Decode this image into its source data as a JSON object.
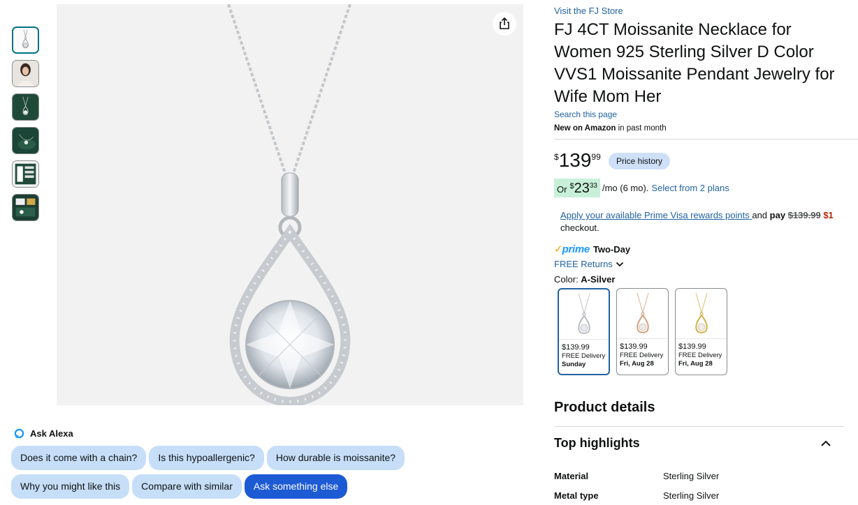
{
  "gallery": {
    "thumbnails": [
      {
        "name": "thumb-pendant-white"
      },
      {
        "name": "thumb-model-wearing"
      },
      {
        "name": "thumb-green-box"
      },
      {
        "name": "thumb-green-display"
      },
      {
        "name": "thumb-infographic"
      },
      {
        "name": "thumb-certificate"
      }
    ],
    "share_icon": "share-icon"
  },
  "alexa": {
    "heading": "Ask Alexa",
    "chips_row1": [
      "Does it come with a chain?",
      "Is this hypoallergenic?",
      "How durable is moissanite?"
    ],
    "chips_row2": [
      "Why you might like this",
      "Compare with similar",
      "Ask something else"
    ]
  },
  "product": {
    "store_link": "Visit the FJ Store",
    "title": "FJ 4CT Moissanite Necklace for Women 925 Sterling Silver D Color VVS1 Moissanite Pendant Jewelry for Wife Mom Her",
    "search_page": "Search this page",
    "new_label": "New on Amazon",
    "new_suffix": " in past month",
    "price": {
      "symbol": "$",
      "whole": "139",
      "fraction": "99"
    },
    "price_history": "Price history",
    "monthly": {
      "or": "Or",
      "symbol": "$",
      "whole": "23",
      "fraction": "33",
      "term": "/mo (6 mo).",
      "plans_link": "Select from 2 plans"
    },
    "prime_visa": {
      "link": "Apply your available Prime Visa rewards points ",
      "and": "and ",
      "pay": "pay",
      "old_price": "$139.99",
      "new_price": "$1",
      "checkout": "checkout."
    },
    "prime": {
      "check": "✓",
      "word": "prime",
      "label": "Two-Day"
    },
    "free_returns": "FREE Returns",
    "color_label": "Color: ",
    "color_value": "A-Silver",
    "swatches": [
      {
        "price": "$139.99",
        "delivery": "FREE Delivery",
        "date": "Sunday",
        "metal": "#c0c4c8"
      },
      {
        "price": "$139.99",
        "delivery": "FREE Delivery",
        "date": "Fri, Aug 28",
        "metal": "#d4a07c"
      },
      {
        "price": "$139.99",
        "delivery": "FREE Delivery",
        "date": "Fri, Aug 28",
        "metal": "#d4b04a"
      }
    ],
    "details_title": "Product details",
    "highlights_title": "Top highlights",
    "specs": [
      {
        "key": "Material",
        "value": "Sterling Silver"
      },
      {
        "key": "Metal type",
        "value": "Sterling Silver"
      }
    ]
  },
  "colors": {
    "link": "#2162a1",
    "chip": "#c6def8",
    "chip_primary": "#1d5bd4",
    "price_red": "#b12704",
    "prime_blue": "#1a98ff",
    "prime_orange": "#ff9900",
    "monthly_green": "#c8f0d8"
  }
}
